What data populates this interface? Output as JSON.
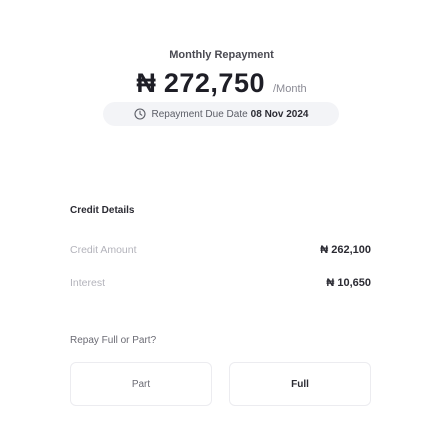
{
  "repayment": {
    "title": "Monthly Repayment",
    "currency_symbol": "₦",
    "amount": "272,750",
    "period": "/Month"
  },
  "due": {
    "icon": "clock-icon",
    "label": "Repayment Due Date",
    "date": "08 Nov 2024"
  },
  "credit_details": {
    "title": "Credit Details",
    "rows": [
      {
        "label": "Credit Amount",
        "value": "₦ 262,100"
      },
      {
        "label": "Interest",
        "value": "₦ 10,650"
      }
    ]
  },
  "repay_option": {
    "question": "Repay Full or Part?",
    "options": [
      "Part",
      "Full"
    ]
  }
}
